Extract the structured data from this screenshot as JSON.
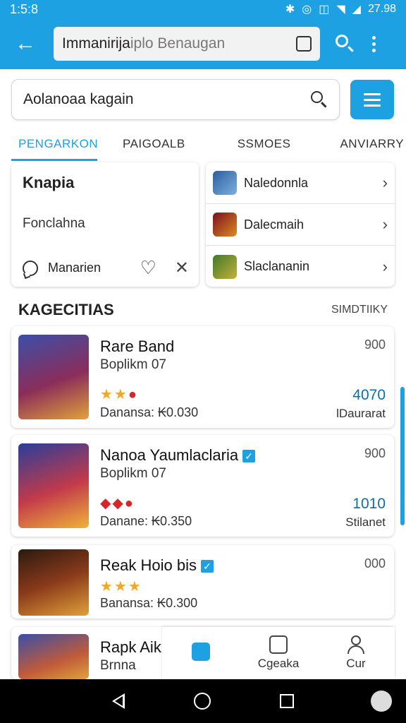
{
  "status_bar": {
    "time": "1:5:8",
    "battery": "27.98",
    "icons": [
      "bluetooth-icon",
      "alarm-icon",
      "vibrate-icon",
      "wifi-icon",
      "signal-icon"
    ]
  },
  "app_bar": {
    "url_text": "Immanirija",
    "url_hint": "iplo Benaugan"
  },
  "search": {
    "value": "Aolanoaa kagain"
  },
  "tabs": [
    {
      "label": "PENGARKON",
      "active": true
    },
    {
      "label": "PAIGOALB",
      "active": false
    },
    {
      "label": "SSMOES",
      "active": false
    },
    {
      "label": "ANVIARRY",
      "active": false
    }
  ],
  "left_card": {
    "title": "Knapia",
    "subtitle": "Fonclahna",
    "action_label": "Manarien"
  },
  "right_list": [
    {
      "label": "Naledonnla"
    },
    {
      "label": "Dalecmaih"
    },
    {
      "label": "Slaclananin"
    }
  ],
  "section": {
    "title": "KAGECITIAS",
    "more": "SIMDTIIKY"
  },
  "apps": [
    {
      "name": "Rare Band",
      "dev": "Boplikm 07",
      "rating": "★★",
      "price": "Danansa:  ₭0.030",
      "count": "900",
      "score": "4070",
      "status": "lDaurarat",
      "verified": false
    },
    {
      "name": "Nanoa Yaumlaclaria",
      "dev": "Boplikm 07",
      "rating": "",
      "price": "Danane:  ₭0.350",
      "count": "900",
      "score": "1010",
      "status": "Stilanet",
      "verified": true
    },
    {
      "name": "Reak Hoio bis",
      "dev": "",
      "rating": "★★★",
      "price": "Banansa:  ₭0.300",
      "count": "000",
      "score": "",
      "status": "",
      "verified": true
    },
    {
      "name": "Rapk Aik",
      "dev": "Brnna",
      "rating": "",
      "price": "",
      "count": "",
      "score": "",
      "status": "",
      "verified": false
    }
  ],
  "bottom_nav": [
    {
      "label": "",
      "active": true
    },
    {
      "label": "Cgeaka",
      "active": false
    },
    {
      "label": "Cur",
      "active": false
    }
  ],
  "colors": {
    "accent": "#1da1e2",
    "score": "#0b6ea8",
    "star": "#f5a623",
    "badge_red": "#d7262b"
  }
}
